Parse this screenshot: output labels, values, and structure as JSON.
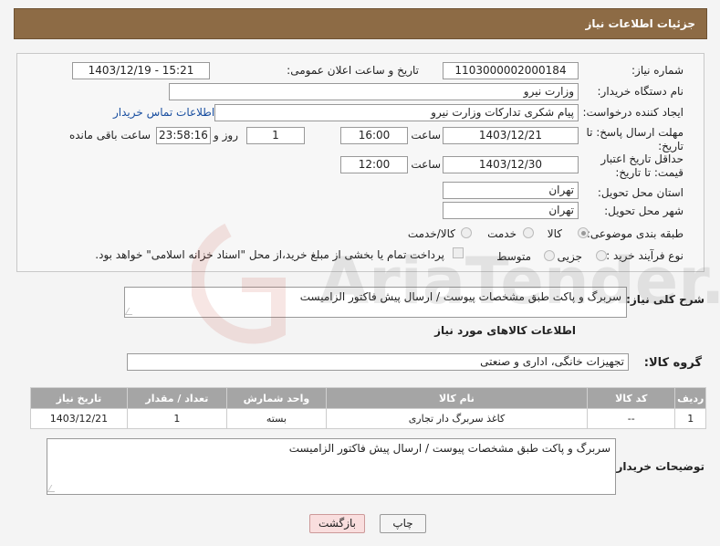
{
  "header": {
    "title": "جزئیات اطلاعات نیاز"
  },
  "form": {
    "need_number_label": "شماره نیاز:",
    "need_number": "1103000002000184",
    "announce_label": "تاریخ و ساعت اعلان عمومی:",
    "announce_value": "1403/12/19 - 15:21",
    "buyer_org_label": "نام دستگاه خریدار:",
    "buyer_org": "وزارت نیرو",
    "creator_label": "ایجاد کننده درخواست:",
    "creator": "پیام شکری تدارکات وزارت نیرو",
    "contact_link": "اطلاعات تماس خریدار",
    "reply_deadline_label": "مهلت ارسال پاسخ: تا تاریخ:",
    "reply_date": "1403/12/21",
    "time_label": "ساعت",
    "reply_time": "16:00",
    "days": "1",
    "days_label": "روز و",
    "remaining": "23:58:16",
    "remaining_label": "ساعت باقی مانده",
    "price_validity_label": "حداقل تاریخ اعتبار قیمت: تا تاریخ:",
    "price_date": "1403/12/30",
    "price_time": "12:00",
    "province_label": "استان محل تحویل:",
    "province": "تهران",
    "city_label": "شهر محل تحویل:",
    "city": "تهران",
    "category_label": "طبقه بندی موضوعی:",
    "category_options": [
      "کالا",
      "خدمت",
      "کالا/خدمت"
    ],
    "process_label": "نوع فرآیند خرید :",
    "process_options": [
      "جزیی",
      "متوسط"
    ],
    "payment_note": "پرداخت تمام یا بخشی از مبلغ خرید،از محل \"اسناد خزانه اسلامی\" خواهد بود."
  },
  "summary": {
    "label": "شرح کلی نیاز:",
    "text": "سربرگ و پاکت طبق مشخصات پیوست / ارسال پیش فاکتور الزامیست"
  },
  "goods_section": {
    "title": "اطلاعات کالاهای مورد نیاز",
    "group_label": "گروه کالا:",
    "group_value": "تجهیزات خانگی، اداری و صنعتی",
    "columns": [
      "ردیف",
      "کد کالا",
      "نام کالا",
      "واحد شمارش",
      "تعداد / مقدار",
      "تاریخ نیاز"
    ],
    "rows": [
      {
        "row": "1",
        "code": "--",
        "name": "کاغذ سربرگ دار تجاری",
        "unit": "بسته",
        "qty": "1",
        "date": "1403/12/21"
      }
    ]
  },
  "buyer_notes": {
    "label": "توضیحات خریدار:",
    "text": "سربرگ و پاکت طبق مشخصات پیوست / ارسال پیش فاکتور الزامیست"
  },
  "buttons": {
    "print": "چاپ",
    "back": "بازگشت"
  },
  "colors": {
    "header_bg": "#8d6b45",
    "table_header_bg": "#a5a5a5",
    "back_button_bg": "#f9dede"
  }
}
